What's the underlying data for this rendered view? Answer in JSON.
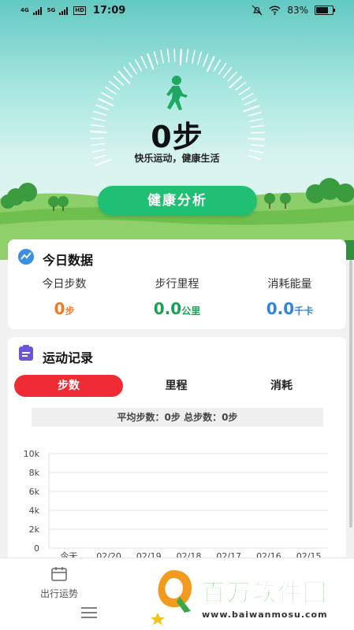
{
  "status_bar": {
    "net1": "4G",
    "net2": "5G",
    "hd": "HD",
    "time": "17:09",
    "battery": "83%",
    "battery_level": 0.83
  },
  "hero": {
    "steps_display": "0步",
    "slogan": "快乐运动，健康生活",
    "analysis_button": "健康分析"
  },
  "today": {
    "title": "今日数据",
    "stats": [
      {
        "label": "今日步数",
        "value": "0",
        "unit": "步",
        "color": "#f07a2b"
      },
      {
        "label": "步行里程",
        "value": "0.0",
        "unit": "公里",
        "color": "#1f9e55"
      },
      {
        "label": "消耗能量",
        "value": "0.0",
        "unit": "千卡",
        "color": "#2f86d8"
      }
    ]
  },
  "record": {
    "title": "运动记录",
    "tabs": [
      {
        "label": "步数",
        "active": true
      },
      {
        "label": "里程",
        "active": false
      },
      {
        "label": "消耗",
        "active": false
      }
    ],
    "summary": "平均步数：0步 总步数：0步"
  },
  "chart_data": {
    "type": "line",
    "ylim": [
      0,
      10000
    ],
    "y_ticks": [
      "0",
      "2k",
      "4k",
      "6k",
      "8k",
      "10k"
    ],
    "categories": [
      "今天",
      "02/20",
      "02/19",
      "02/18",
      "02/17",
      "02/16",
      "02/15"
    ],
    "values": [
      0,
      0,
      0,
      0,
      0,
      0,
      0
    ]
  },
  "bottom_nav": {
    "item_label": "出行运势"
  },
  "watermark": {
    "title": "百万软件园",
    "url": "www.baiwanmosu.com"
  },
  "colors": {
    "accent_green": "#1fc073",
    "tab_active": "#ef2c35"
  }
}
